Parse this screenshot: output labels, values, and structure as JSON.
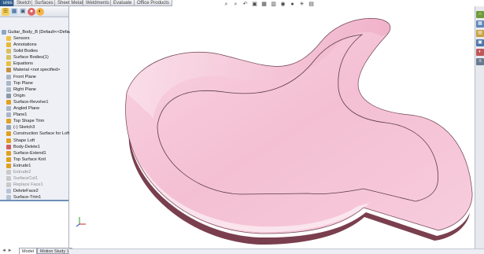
{
  "command_tabs": [
    {
      "label": "Features",
      "display": "ures",
      "active": true
    },
    {
      "label": "Sketch",
      "display": "Sketch",
      "active": false
    },
    {
      "label": "Surfaces",
      "display": "Surfaces",
      "active": false
    },
    {
      "label": "Sheet Metal",
      "display": "Sheet Metal",
      "active": false
    },
    {
      "label": "Weldments",
      "display": "Weldments",
      "active": false
    },
    {
      "label": "Evaluate",
      "display": "Evaluate",
      "active": false
    },
    {
      "label": "Office Products",
      "display": "Office Products",
      "active": false
    }
  ],
  "feature_tree": {
    "root_label": "Guitar_Body_B (Default<<Defau",
    "items": [
      {
        "label": "Sensors",
        "icon": "sensors-icon",
        "color": "#f0c040"
      },
      {
        "label": "Annotations",
        "icon": "annotations-icon",
        "color": "#e8b830"
      },
      {
        "label": "Solid Bodies",
        "icon": "solid-bodies-icon",
        "color": "#d8c060"
      },
      {
        "label": "Surface Bodies(1)",
        "icon": "surface-bodies-icon",
        "color": "#d8c060"
      },
      {
        "label": "Equations",
        "icon": "equations-icon",
        "color": "#e8c040"
      },
      {
        "label": "Material <not specified>",
        "icon": "material-icon",
        "color": "#c89040"
      },
      {
        "label": "Front Plane",
        "icon": "plane-icon",
        "color": "#a9b6c8"
      },
      {
        "label": "Top Plane",
        "icon": "plane-icon",
        "color": "#a9b6c8"
      },
      {
        "label": "Right Plane",
        "icon": "plane-icon",
        "color": "#a9b6c8"
      },
      {
        "label": "Origin",
        "icon": "origin-icon",
        "color": "#8b98aa"
      },
      {
        "label": "Surface-Revolve1",
        "icon": "surface-revolve-icon",
        "color": "#e0a020"
      },
      {
        "label": "Angled Plane",
        "icon": "plane-icon",
        "color": "#a9b6c8"
      },
      {
        "label": "Plane1",
        "icon": "plane-icon",
        "color": "#a9b6c8"
      },
      {
        "label": "Top Shape Trim",
        "icon": "surface-trim-icon",
        "color": "#e0a020"
      },
      {
        "label": "(-) Sketch3",
        "icon": "sketch-icon",
        "color": "#9aa6b6"
      },
      {
        "label": "Construction Surface for Loft",
        "icon": "surface-icon",
        "color": "#e0a020"
      },
      {
        "label": "Shape Loft",
        "icon": "loft-icon",
        "color": "#e0a020"
      },
      {
        "label": "Body-Delete1",
        "icon": "body-delete-icon",
        "color": "#d06060"
      },
      {
        "label": "Surface-Extend1",
        "icon": "surface-extend-icon",
        "color": "#e0a020"
      },
      {
        "label": "Top Surface Knit",
        "icon": "surface-knit-icon",
        "color": "#e0a020"
      },
      {
        "label": "Extrude1",
        "icon": "extrude-icon",
        "color": "#e0a020"
      },
      {
        "label": "Extrude2",
        "icon": "extrude-icon",
        "color": "#c9c9c9",
        "gray": true
      },
      {
        "label": "SurfaceCut1",
        "icon": "surface-cut-icon",
        "color": "#c9c9c9",
        "gray": true
      },
      {
        "label": "Replace Face1",
        "icon": "replace-face-icon",
        "color": "#c9c9c9",
        "gray": true
      },
      {
        "label": "DeleteFace2",
        "icon": "delete-face-icon",
        "color": "#b7c4d6"
      },
      {
        "label": "Surface-Trim1",
        "icon": "surface-trim-icon",
        "color": "#b7c4d6"
      }
    ]
  },
  "bottom_tabs": [
    {
      "label": "Model",
      "active": true
    },
    {
      "label": "Motion Study 1",
      "active": false
    }
  ],
  "nav_arrows": "◄ ►",
  "hud_icons": [
    "zoom-to-fit-icon",
    "zoom-area-icon",
    "previous-view-icon",
    "section-view-icon",
    "view-orientation-icon",
    "display-style-icon",
    "hide-show-icon",
    "edit-appearance-icon",
    "apply-scene-icon",
    "view-settings-icon"
  ],
  "hud_glyphs": [
    "⌕",
    "⌕",
    "↶",
    "▣",
    "▦",
    "▥",
    "◉",
    "●",
    "☀",
    "▤"
  ],
  "taskpane_icons": [
    "solidworks-resources-icon",
    "design-library-icon",
    "file-explorer-icon",
    "view-palette-icon",
    "appearances-icon",
    "custom-properties-icon"
  ],
  "taskpane_glyphs": [
    "⌂",
    "▦",
    "▤",
    "▣",
    "◐",
    "≡"
  ],
  "colors": {
    "body_top": "#f6c3d5",
    "body_side": "#7a3f4e",
    "accent_tab": "#2f5f8f"
  }
}
